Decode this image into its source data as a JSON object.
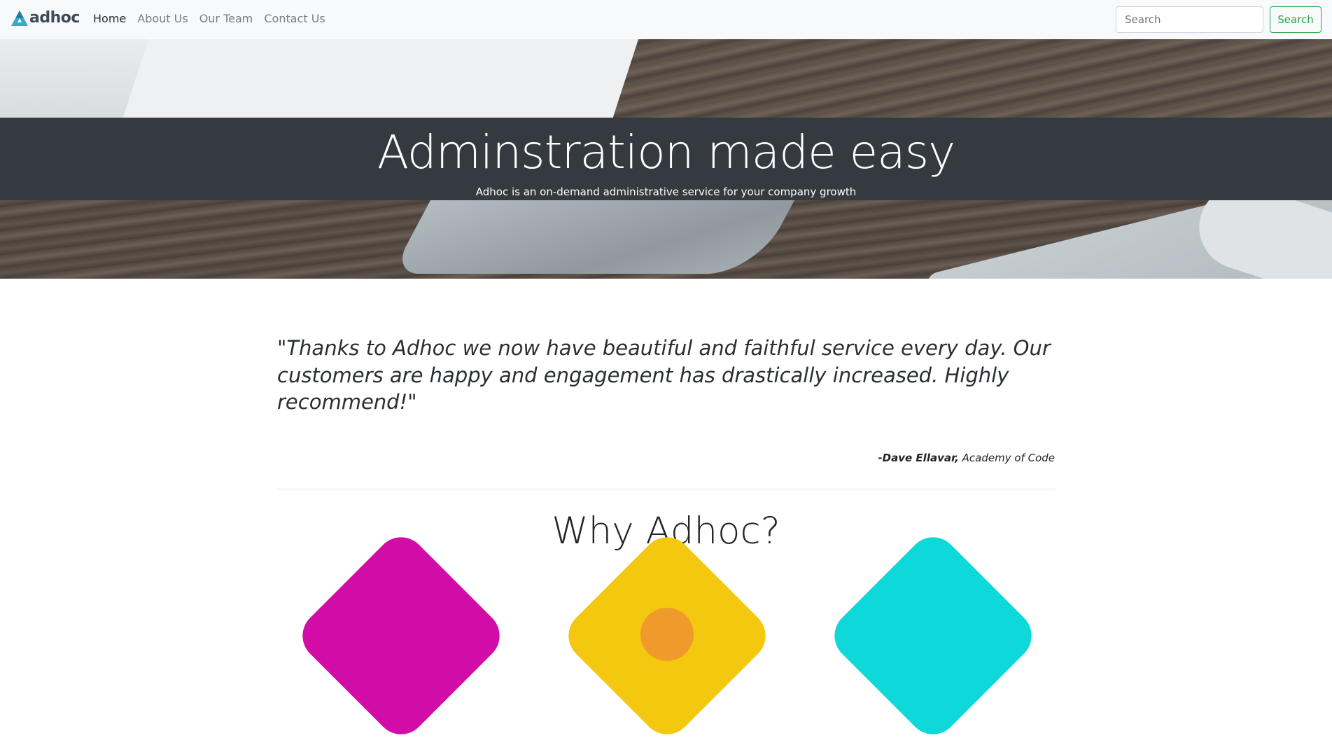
{
  "navbar": {
    "brand": "adhoc",
    "links": [
      {
        "label": "Home",
        "active": true
      },
      {
        "label": "About Us",
        "active": false
      },
      {
        "label": "Our Team",
        "active": false
      },
      {
        "label": "Contact Us",
        "active": false
      }
    ],
    "search_placeholder": "Search",
    "search_button": "Search"
  },
  "hero": {
    "title": "Adminstration made easy",
    "subtitle": "Adhoc is an on-demand administrative service for your company growth"
  },
  "testimonial": {
    "quote": "\"Thanks to Adhoc we now have beautiful and faithful service every day. Our customers are happy and engagement has drastically increased. Highly recommend!\"",
    "author": "-Dave Ellavar,",
    "organization": "Academy of Code"
  },
  "why": {
    "title": "Why Adhoc?",
    "features": [
      {
        "color": "#d10ca7"
      },
      {
        "color": "#f3c80e"
      },
      {
        "color": "#0fd8da"
      }
    ]
  },
  "colors": {
    "navbar_bg": "#f8f9fa",
    "hero_band": "#343a40",
    "success": "#28a745",
    "brand_icon": "#2a9fbc"
  }
}
